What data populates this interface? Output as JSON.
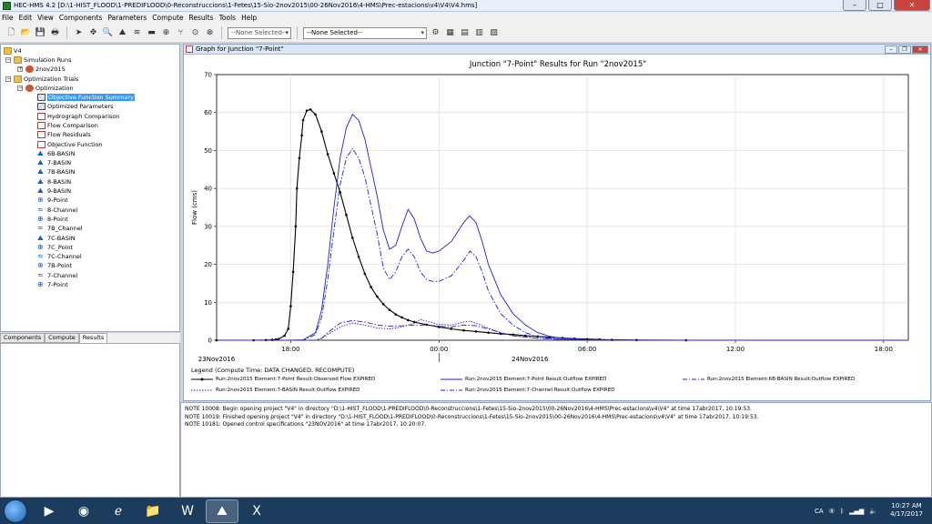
{
  "window": {
    "title": "HEC-HMS 4.2 [D:\\1-HIST_FLOOD\\1-PREDIFLOOD\\0-Reconstruccions\\1-Fetes\\15-Sio-2nov2015\\00-26Nov2016\\4-HMS\\Prec-estacions\\v4\\V4\\V4.hms]"
  },
  "menu": [
    "File",
    "Edit",
    "View",
    "Components",
    "Parameters",
    "Compute",
    "Results",
    "Tools",
    "Help"
  ],
  "toolbar": {
    "combo1": "--None Selected--",
    "combo2": "--None Selected--"
  },
  "tree": {
    "root": "V4",
    "simulation_runs": "Simulation Runs",
    "run": "2nov2015",
    "optimization_trials": "Optimization Trials",
    "optimization": "Optimization",
    "items": [
      {
        "label": "Objective Function Summary",
        "icon": "table-icon",
        "selected": true
      },
      {
        "label": "Optimized Parameters",
        "icon": "table-icon"
      },
      {
        "label": "Hydrograph Comparison",
        "icon": "graph-icon"
      },
      {
        "label": "Flow Comparison",
        "icon": "graph-icon"
      },
      {
        "label": "Flow Residuals",
        "icon": "graph-icon"
      },
      {
        "label": "Objective Function",
        "icon": "graph-icon"
      },
      {
        "label": "6B-BASIN",
        "icon": "basin-icon"
      },
      {
        "label": "7-BASIN",
        "icon": "basin-icon"
      },
      {
        "label": "7B-BASIN",
        "icon": "basin-icon"
      },
      {
        "label": "8-BASIN",
        "icon": "basin-icon"
      },
      {
        "label": "9-BASIN",
        "icon": "basin-icon"
      },
      {
        "label": "9-Point",
        "icon": "junction-icon"
      },
      {
        "label": "8-Channel",
        "icon": "reach-icon"
      },
      {
        "label": "8-Point",
        "icon": "junction-icon"
      },
      {
        "label": "7B_Channel",
        "icon": "reach-icon"
      },
      {
        "label": "7C-BASIN",
        "icon": "basin-icon"
      },
      {
        "label": "7C_Point",
        "icon": "junction-icon"
      },
      {
        "label": "7C-Channel",
        "icon": "reach-icon"
      },
      {
        "label": "7B-Point",
        "icon": "junction-icon"
      },
      {
        "label": "7-Channel",
        "icon": "reach-icon"
      },
      {
        "label": "7-Point",
        "icon": "junction-icon"
      }
    ]
  },
  "tabs": [
    "Components",
    "Compute",
    "Results"
  ],
  "graph_window": {
    "title": "Graph for Junction \"7-Point\""
  },
  "chart_data": {
    "type": "line",
    "title": "Junction \"7-Point\" Results for Run \"2nov2015\"",
    "ylabel": "Flow (cms)",
    "ylim": [
      0,
      70
    ],
    "yticks": [
      0,
      10,
      20,
      30,
      40,
      50,
      60,
      70
    ],
    "xlim": [
      0,
      56
    ],
    "xticks": [
      {
        "h": 6,
        "label": "18:00"
      },
      {
        "h": 18,
        "label": "00:00"
      },
      {
        "h": 30,
        "label": "06:00"
      },
      {
        "h": 42,
        "label": "12:00"
      },
      {
        "h": 54,
        "label": "18:00"
      }
    ],
    "date_labels": [
      {
        "h": 0,
        "label": "23Nov2016"
      },
      {
        "h": 18,
        "label": "24Nov2016"
      }
    ],
    "grid": true,
    "series": [
      {
        "name": "Run:2nov2015 Element:7-Point Result:Observed Flow EXPIRED",
        "style": "observed",
        "color": "#000000",
        "x": [
          0,
          3,
          4,
          4.5,
          4.8,
          5,
          5.5,
          5.8,
          6,
          6.2,
          6.4,
          6.5,
          6.7,
          6.9,
          7,
          7.3,
          7.6,
          8,
          8.5,
          9,
          9.5,
          10,
          10.5,
          11,
          11.5,
          12,
          12.5,
          13,
          13.5,
          14,
          14.5,
          15,
          15.5,
          16,
          17,
          18,
          19,
          20,
          21,
          22,
          23,
          24,
          25,
          26,
          27,
          28,
          29,
          30,
          31,
          32,
          34,
          38,
          44,
          50,
          56
        ],
        "y": [
          0,
          0,
          0.05,
          0.1,
          0.2,
          0.3,
          1.2,
          3,
          9,
          18,
          30,
          40,
          48,
          54,
          58,
          60.5,
          60.8,
          59.5,
          55,
          49,
          44,
          39,
          33,
          27,
          22,
          17.5,
          14,
          11.5,
          9.5,
          8,
          6.8,
          6,
          5.3,
          4.8,
          4.1,
          3.5,
          3,
          2.6,
          2.3,
          2,
          1.7,
          1.5,
          1.2,
          1,
          0.8,
          0.6,
          0.4,
          0.3,
          0.2,
          0.1,
          0.05,
          0,
          0,
          0,
          0
        ]
      },
      {
        "name": "Run:2nov2015 Element:7-Point Result:Outflow EXPIRED",
        "style": "solid",
        "color": "#2020d0",
        "x": [
          0,
          6,
          7,
          8,
          8.5,
          9,
          9.5,
          10,
          10.5,
          11,
          11.5,
          12,
          13,
          13.5,
          14,
          14.5,
          15,
          15.5,
          16,
          16.5,
          17,
          17.5,
          18,
          19,
          20,
          20.5,
          21,
          21.5,
          22,
          23,
          24,
          25,
          26,
          27,
          28,
          30,
          32,
          34,
          38,
          44,
          50,
          56
        ],
        "y": [
          0,
          0,
          0.1,
          2,
          8,
          20,
          35,
          48,
          56,
          59.5,
          58,
          53,
          38,
          29,
          24,
          25,
          30,
          34.5,
          32,
          27,
          23.5,
          23,
          23.5,
          26,
          31,
          32.8,
          31,
          26,
          20,
          12,
          7,
          4,
          2,
          1,
          0.5,
          0.2,
          0.1,
          0,
          0,
          0,
          0,
          0
        ]
      },
      {
        "name": "Run:2nov2015 Element:6B-BASIN Result:Outflow EXPIRED",
        "style": "dashdot",
        "color": "#2020d0",
        "x": [
          0,
          7,
          8,
          8.5,
          9,
          9.5,
          10,
          10.5,
          11,
          11.5,
          12,
          13,
          13.5,
          14,
          14.5,
          15,
          15.5,
          16,
          16.5,
          17,
          17.5,
          18,
          19,
          20,
          20.5,
          21,
          21.5,
          22,
          23,
          24,
          25,
          26,
          27,
          28,
          30,
          32,
          34,
          38,
          44,
          50,
          56
        ],
        "y": [
          0,
          0,
          1.5,
          6,
          16,
          29,
          41,
          48,
          50.5,
          48,
          43,
          28,
          19,
          16,
          18,
          22,
          24,
          22,
          18,
          16,
          15.5,
          15.5,
          17,
          21,
          23.5,
          22,
          18,
          13,
          7,
          4,
          2,
          1,
          0.5,
          0.2,
          0.1,
          0,
          0,
          0,
          0,
          0,
          0
        ]
      },
      {
        "name": "Run:2nov2015 Element:7-BASIN Result:Outflow EXPIRED",
        "style": "dotted",
        "color": "#2020d0",
        "x": [
          0,
          8,
          8.5,
          9,
          10,
          11,
          12,
          13,
          14,
          15,
          16,
          16.5,
          17,
          18,
          19,
          20,
          20.5,
          21,
          22,
          23,
          24,
          26,
          28,
          32,
          40,
          56
        ],
        "y": [
          0,
          0,
          0.5,
          1.5,
          3.5,
          4.5,
          4,
          3.2,
          3,
          3.5,
          4.5,
          5.5,
          5,
          4.2,
          4,
          4.8,
          5,
          4.5,
          3.2,
          2,
          1.2,
          0.5,
          0.2,
          0,
          0,
          0
        ]
      },
      {
        "name": "Run:2nov2015 Element:7-Channel Result:Outflow EXPIRED",
        "style": "dashdot",
        "color": "#2020d0",
        "x": [
          0,
          8,
          8.5,
          9,
          10,
          11,
          12,
          13,
          14,
          15,
          16,
          17,
          18,
          19,
          20,
          21,
          22,
          23,
          24,
          26,
          28,
          32,
          40,
          56
        ],
        "y": [
          0,
          0,
          0.5,
          2,
          4.5,
          5.2,
          4.8,
          4,
          3.7,
          3.8,
          4,
          4,
          3.7,
          3.5,
          4,
          3.8,
          3,
          2,
          1.2,
          0.5,
          0.2,
          0,
          0,
          0
        ]
      }
    ]
  },
  "legend_header": "Legend (Compute Time: DATA CHANGED, RECOMPUTE)",
  "notes": [
    "NOTE 10008:  Begin opening project \"V4\" in directory \"D:\\1-HIST_FLOOD\\1-PREDIFLOOD\\0-Reconstruccions\\1-Fetes\\15-Sio-2nov2015\\00-26Nov2016\\4-HMS\\Prec-estacions\\v4\\V4\" at time 17abr2017, 10:19:53.",
    "NOTE 10019:  Finished opening project \"V4\" in directory \"D:\\1-HIST_FLOOD\\1-PREDIFLOOD\\0-Reconstruccions\\1-Fetes\\15-Sio-2nov2015\\00-26Nov2016\\4-HMS\\Prec-estacions\\v4\\V4\" at time 17abr2017, 10:19:53.",
    "NOTE 10181:  Opened control specifications \"23NOV2016\" at time 17abr2017, 10:20:07."
  ],
  "taskbar": {
    "lang": "CA",
    "time": "10:27 AM",
    "date": "4/17/2017"
  }
}
